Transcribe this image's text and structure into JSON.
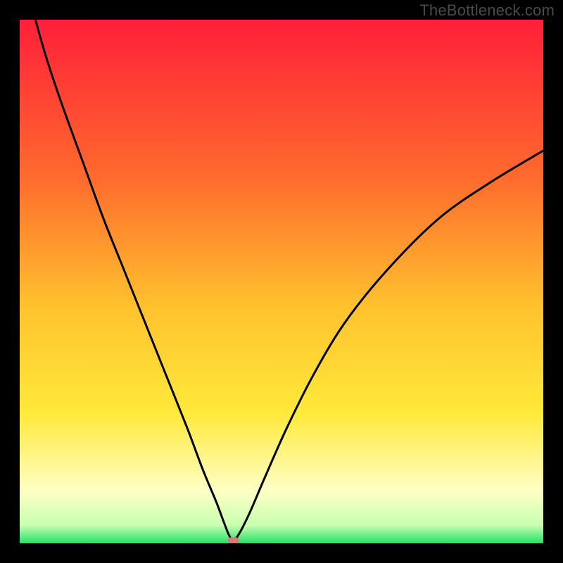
{
  "watermark": "TheBottleneck.com",
  "colors": {
    "frame": "#000000",
    "curve": "#000000",
    "marker_fill": "#cf7d78",
    "gradient_top": "#ff1f3a",
    "gradient_mid_upper": "#ff8a2a",
    "gradient_mid": "#ffe93a",
    "gradient_pale": "#feffc5",
    "gradient_bottom": "#27e06a"
  },
  "chart_data": {
    "type": "line",
    "title": "",
    "xlabel": "",
    "ylabel": "",
    "xlim": [
      0,
      100
    ],
    "ylim": [
      0,
      100
    ],
    "grid": false,
    "legend": false,
    "series": [
      {
        "name": "curve",
        "x": [
          3,
          5,
          8,
          12,
          16,
          20,
          24,
          28,
          32,
          35,
          37.5,
          39,
          40,
          40.8,
          42,
          44,
          47,
          51,
          56,
          62,
          70,
          80,
          90,
          100
        ],
        "y": [
          100,
          93,
          84,
          73,
          62,
          52,
          42,
          32,
          22,
          14,
          8,
          4,
          1.5,
          0.5,
          2,
          6,
          13,
          22,
          32,
          42,
          52,
          62,
          69,
          75
        ]
      }
    ],
    "annotations": [
      {
        "name": "marker",
        "x": 40.8,
        "y": 0.5,
        "shape": "rounded-rect"
      }
    ],
    "background_gradient": {
      "direction": "vertical",
      "stops": [
        {
          "pos": 0.0,
          "color": "#ff1f3a"
        },
        {
          "pos": 0.3,
          "color": "#ff6a2e"
        },
        {
          "pos": 0.55,
          "color": "#ffc22e"
        },
        {
          "pos": 0.75,
          "color": "#ffe93a"
        },
        {
          "pos": 0.9,
          "color": "#feffc5"
        },
        {
          "pos": 0.965,
          "color": "#c8ffb0"
        },
        {
          "pos": 1.0,
          "color": "#27e06a"
        }
      ]
    }
  }
}
